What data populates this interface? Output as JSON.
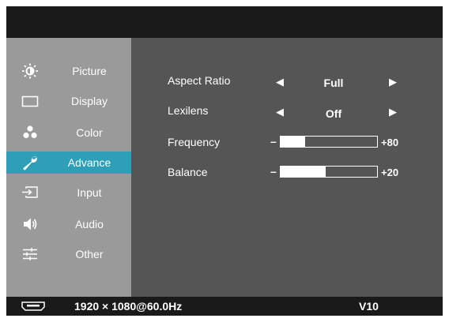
{
  "sidebar": {
    "items": [
      {
        "label": "Picture",
        "icon": "brightness-icon",
        "active": false
      },
      {
        "label": "Display",
        "icon": "display-icon",
        "active": false
      },
      {
        "label": "Color",
        "icon": "color-dots-icon",
        "active": false
      },
      {
        "label": "Advance",
        "icon": "wrench-icon",
        "active": true
      },
      {
        "label": "Input",
        "icon": "input-icon",
        "active": false
      },
      {
        "label": "Audio",
        "icon": "speaker-icon",
        "active": false
      },
      {
        "label": "Other",
        "icon": "sliders-icon",
        "active": false
      }
    ]
  },
  "advance": {
    "aspect_ratio": {
      "label": "Aspect Ratio",
      "value": "Full"
    },
    "lexilens": {
      "label": "Lexilens",
      "value": "Off"
    },
    "frequency": {
      "label": "Frequency",
      "minus": "–",
      "value_label": "+80",
      "value": 80,
      "min": 0,
      "max": 100
    },
    "balance": {
      "label": "Balance",
      "minus": "–",
      "value_label": "+20",
      "value": 20,
      "min": -50,
      "max": 50
    }
  },
  "footer": {
    "resolution": "1920 × 1080@60.0Hz",
    "version": "V10",
    "icon": "hdmi-port-icon"
  },
  "colors": {
    "accent": "#2f9fb8",
    "sidebar_bg": "#9a9a9a",
    "panel_bg": "#555555",
    "frame_bg": "#1a1a1a"
  }
}
